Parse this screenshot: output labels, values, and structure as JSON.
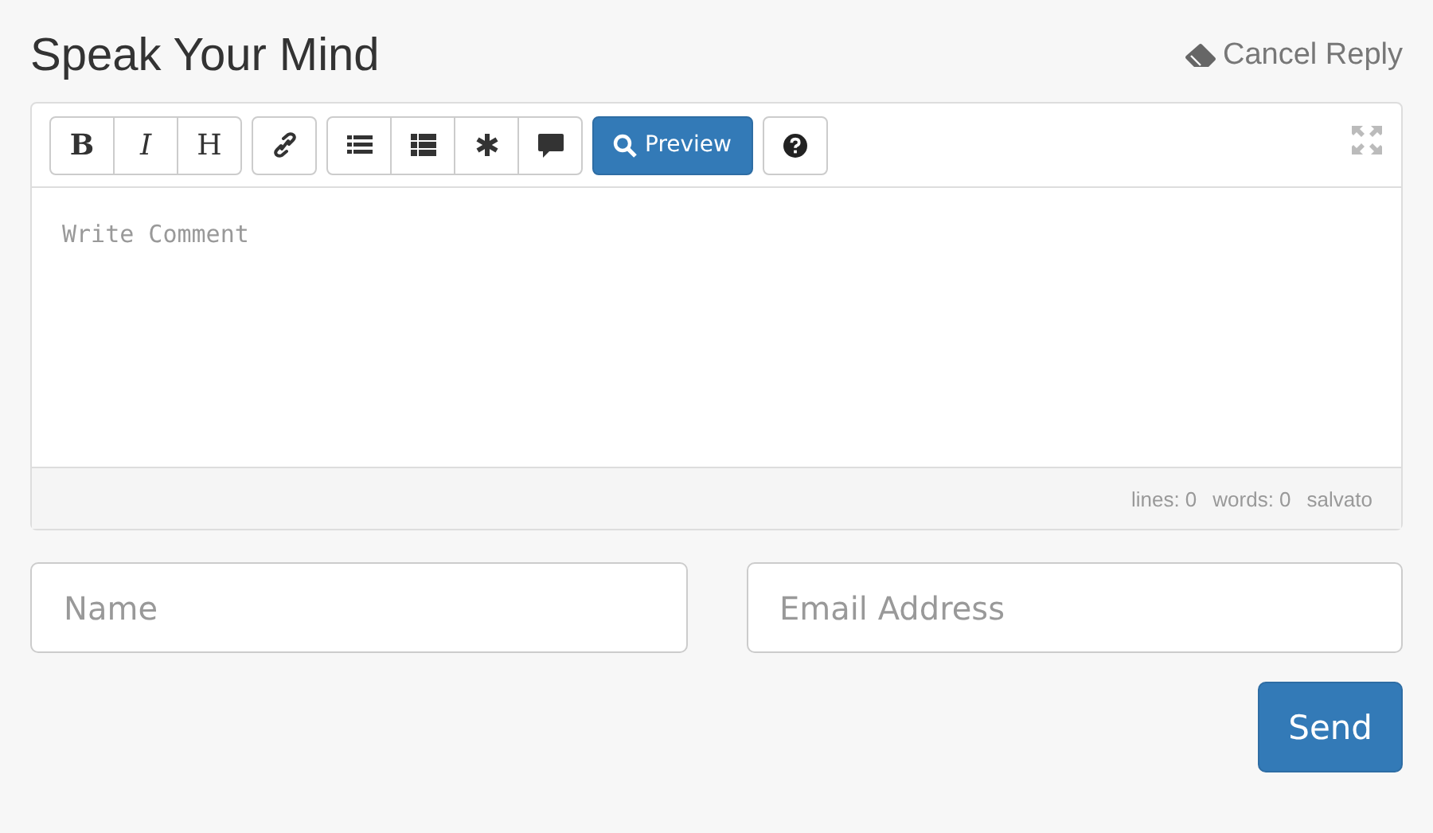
{
  "heading": "Speak Your Mind",
  "cancel_reply": "Cancel Reply",
  "toolbar": {
    "groups": [
      [
        {
          "kind": "bold",
          "label": "B"
        },
        {
          "kind": "italic",
          "label": "I"
        },
        {
          "kind": "heading",
          "label": "H"
        }
      ],
      [
        {
          "kind": "link"
        }
      ],
      [
        {
          "kind": "bullet-list"
        },
        {
          "kind": "numbered-list"
        },
        {
          "kind": "asterisk"
        },
        {
          "kind": "comment"
        }
      ],
      [
        {
          "kind": "preview",
          "label": "Preview"
        }
      ],
      [
        {
          "kind": "help"
        }
      ]
    ]
  },
  "editor": {
    "placeholder": "Write Comment"
  },
  "status_bar": [
    "lines: 0",
    "words: 0",
    "salvato"
  ],
  "name_field": {
    "placeholder": "Name"
  },
  "email_field": {
    "placeholder": "Email Address"
  },
  "send_button": "Send"
}
